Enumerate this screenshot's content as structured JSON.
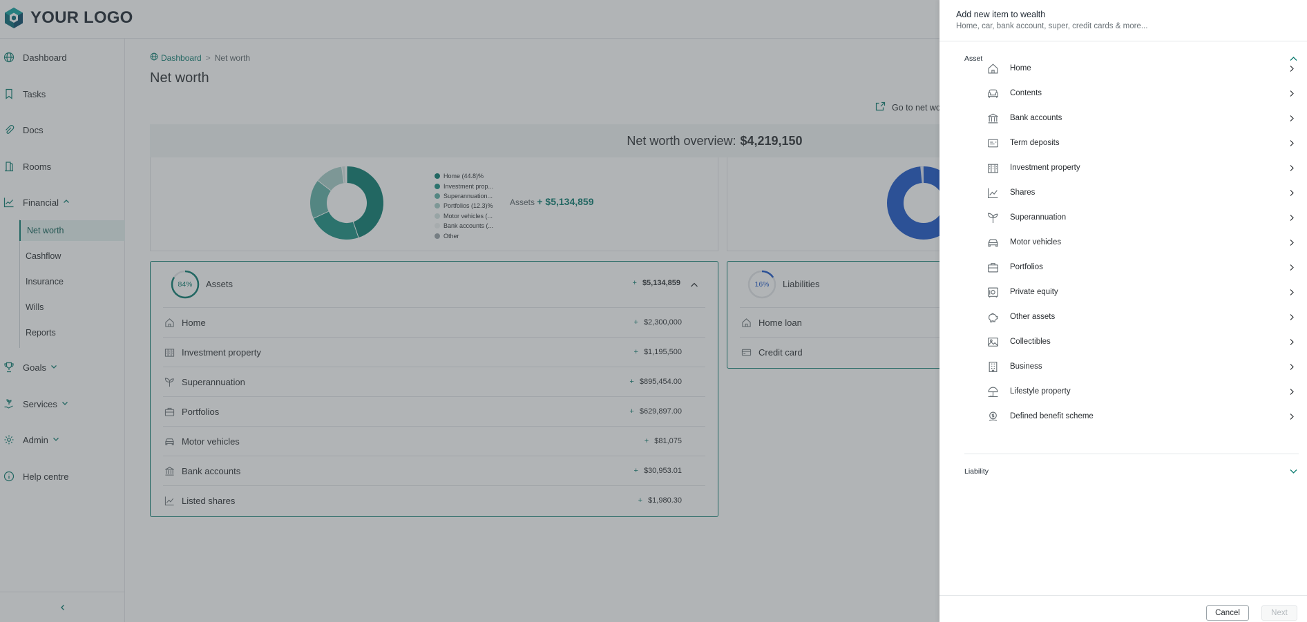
{
  "colors": {
    "accent": "#0a7a6e",
    "blue": "#1a55c8"
  },
  "brand": {
    "logo_text": "YOUR LOGO"
  },
  "sidebar": {
    "items": [
      {
        "label": "Dashboard",
        "icon": "globe-icon"
      },
      {
        "label": "Tasks",
        "icon": "bookmark-icon"
      },
      {
        "label": "Docs",
        "icon": "paperclip-icon"
      },
      {
        "label": "Rooms",
        "icon": "door-icon"
      },
      {
        "label": "Financial",
        "icon": "trend-icon"
      },
      {
        "label": "Goals",
        "icon": "trophy-icon"
      },
      {
        "label": "Services",
        "icon": "hand-plant-icon"
      },
      {
        "label": "Admin",
        "icon": "gear-icon"
      },
      {
        "label": "Help centre",
        "icon": "info-icon"
      }
    ],
    "financial_sub": [
      "Net worth",
      "Cashflow",
      "Insurance",
      "Wills",
      "Reports"
    ],
    "active_sub": "Net worth"
  },
  "breadcrumb": {
    "home": "Dashboard",
    "separator": ">",
    "current": "Net worth"
  },
  "page": {
    "title": "Net worth",
    "goto_label": "Go to net wo"
  },
  "overview": {
    "label": "Net worth overview:",
    "value": "$4,219,150"
  },
  "assets_chart": {
    "legend": [
      {
        "label": "Home (44.8)%",
        "color": "#0a7a6e"
      },
      {
        "label": "Investment prop...",
        "color": "#1a8f82"
      },
      {
        "label": "Superannuation...",
        "color": "#5fb0a6"
      },
      {
        "label": "Portfolios (12.3)%",
        "color": "#a5cdc8"
      },
      {
        "label": "Motor vehicles (...",
        "color": "#d4e4e2"
      },
      {
        "label": "Bank accounts (...",
        "color": "#eef2f2"
      },
      {
        "label": "Other",
        "color": "#9aa3a8"
      }
    ],
    "sum_label": "Assets",
    "sum_value": "+ $5,134,859"
  },
  "chart_data": {
    "type": "pie",
    "title": "",
    "categories": [
      "Home",
      "Investment property",
      "Superannuation",
      "Portfolios",
      "Motor vehicles",
      "Bank accounts",
      "Other"
    ],
    "values": [
      44.8,
      23.3,
      17.4,
      12.3,
      1.6,
      0.6,
      0.04
    ]
  },
  "assets_card": {
    "percent": "84%",
    "percent_value": 84,
    "title": "Assets",
    "total_sign": "+",
    "total": "$5,134,859",
    "rows": [
      {
        "label": "Home",
        "amount": "$2,300,000",
        "icon": "home-icon"
      },
      {
        "label": "Investment property",
        "amount": "$1,195,500",
        "icon": "building-icon"
      },
      {
        "label": "Superannuation",
        "amount": "$895,454.00",
        "icon": "sprout-icon"
      },
      {
        "label": "Portfolios",
        "amount": "$629,897.00",
        "icon": "briefcase-icon"
      },
      {
        "label": "Motor vehicles",
        "amount": "$81,075",
        "icon": "car-icon"
      },
      {
        "label": "Bank accounts",
        "amount": "$30,953.01",
        "icon": "bank-icon"
      },
      {
        "label": "Listed shares",
        "amount": "$1,980.30",
        "icon": "chart-line-icon"
      }
    ]
  },
  "liabilities_card": {
    "percent": "16%",
    "percent_value": 16,
    "title": "Liabilities",
    "rows": [
      {
        "label": "Home loan",
        "icon": "home-icon"
      },
      {
        "label": "Credit card",
        "icon": "credit-card-icon"
      }
    ]
  },
  "drawer": {
    "title": "Add new item to wealth",
    "subtitle": "Home, car, bank account, super, credit cards & more...",
    "asset_section": "Asset",
    "liability_section": "Liability",
    "asset_options": [
      {
        "label": "Home",
        "icon": "home-icon"
      },
      {
        "label": "Contents",
        "icon": "sofa-icon"
      },
      {
        "label": "Bank accounts",
        "icon": "bank-icon"
      },
      {
        "label": "Term deposits",
        "icon": "certificate-icon"
      },
      {
        "label": "Investment property",
        "icon": "building-icon"
      },
      {
        "label": "Shares",
        "icon": "chart-line-icon"
      },
      {
        "label": "Superannuation",
        "icon": "sprout-icon"
      },
      {
        "label": "Motor vehicles",
        "icon": "car-icon"
      },
      {
        "label": "Portfolios",
        "icon": "briefcase-icon"
      },
      {
        "label": "Private equity",
        "icon": "safe-icon"
      },
      {
        "label": "Other assets",
        "icon": "piggy-bank-icon"
      },
      {
        "label": "Collectibles",
        "icon": "image-icon"
      },
      {
        "label": "Business",
        "icon": "office-icon"
      },
      {
        "label": "Lifestyle property",
        "icon": "umbrella-icon"
      },
      {
        "label": "Defined benefit scheme",
        "icon": "benefit-icon"
      }
    ],
    "cancel_label": "Cancel",
    "next_label": "Next"
  }
}
